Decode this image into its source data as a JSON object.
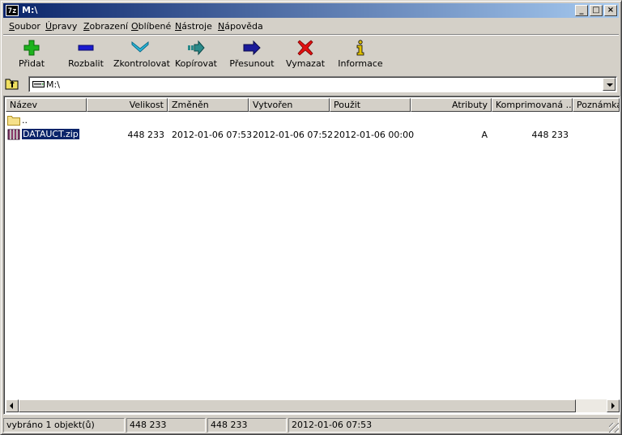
{
  "window": {
    "title": "M:\\",
    "app_icon_text": "7z"
  },
  "menu": [
    {
      "accel": "S",
      "rest": "oubor"
    },
    {
      "accel": "Ú",
      "rest": "pravy"
    },
    {
      "accel": "Z",
      "rest": "obrazení"
    },
    {
      "accel": "O",
      "rest": "blíbené"
    },
    {
      "accel": "N",
      "rest": "ástroje"
    },
    {
      "accel": "N",
      "rest": "ápověda"
    }
  ],
  "toolbar": [
    {
      "label": "Přidat",
      "icon": "plus-icon",
      "color": "#1db31d"
    },
    {
      "label": "Rozbalit",
      "icon": "minus-icon",
      "color": "#1a1ad0"
    },
    {
      "label": "Zkontrolovat",
      "icon": "check-chevron-icon",
      "color": "#2ab8d8"
    },
    {
      "label": "Kopírovat",
      "icon": "copy-arrow-icon",
      "color": "#2a8a8a"
    },
    {
      "label": "Přesunout",
      "icon": "move-arrow-icon",
      "color": "#1a1a9a"
    },
    {
      "label": "Vymazat",
      "icon": "delete-x-icon",
      "color": "#e01010"
    },
    {
      "label": "Informace",
      "icon": "info-icon",
      "color": "#e0c000"
    }
  ],
  "address": {
    "value": "M:\\"
  },
  "columns": [
    "Název",
    "Velikost",
    "Změněn",
    "Vytvořen",
    "Použit",
    "Atributy",
    "Komprimovaná ...",
    "Poznámka"
  ],
  "rows": [
    {
      "name": "..",
      "icon": "folder-icon",
      "size": "",
      "modified": "",
      "created": "",
      "accessed": "",
      "attributes": "",
      "packed": ""
    },
    {
      "name": "DATAUCT.zip",
      "icon": "archive-icon",
      "size": "448 233",
      "modified": "2012-01-06 07:53",
      "created": "2012-01-06 07:52",
      "accessed": "2012-01-06 00:00",
      "attributes": "A",
      "packed": "448 233"
    }
  ],
  "status": [
    "vybráno 1 objekt(ů)",
    "448 233",
    "448 233",
    "2012-01-06 07:53"
  ]
}
